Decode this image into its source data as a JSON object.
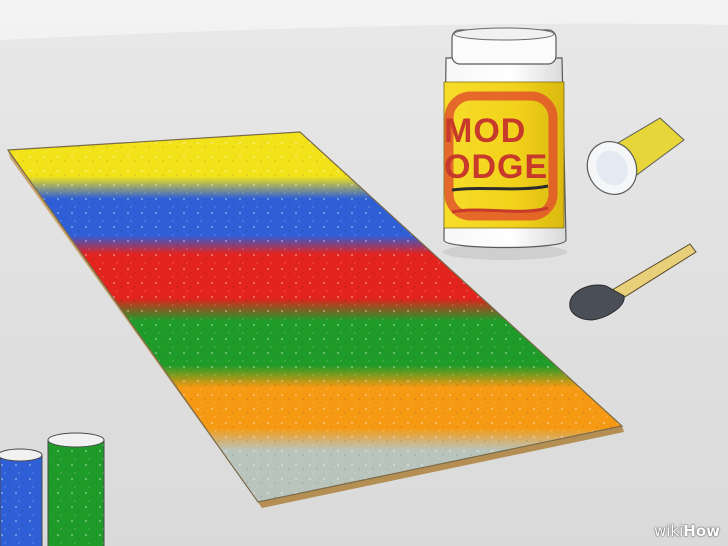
{
  "scene": {
    "description_colors": {
      "background_top": "#f4f4f4",
      "background_bottom": "#d9d9d9",
      "board_edge": "#c9a46a",
      "jar_label": "#f2d21a",
      "jar_lid": "#f7f7f7",
      "jar_text": "#c7392a",
      "brush_handle": "#e8cf7a",
      "brush_sponge": "#4a4f57"
    },
    "sand_bands": [
      {
        "name": "yellow",
        "color": "#f2e21a"
      },
      {
        "name": "blue",
        "color": "#2f5fd6"
      },
      {
        "name": "red",
        "color": "#e2231e"
      },
      {
        "name": "green",
        "color": "#1f9b2a"
      },
      {
        "name": "orange",
        "color": "#f59a12"
      },
      {
        "name": "silver",
        "color": "#b9c4bd"
      }
    ],
    "jar_text_line1": "MOD",
    "jar_text_line2": "ODGE",
    "small_jars": [
      {
        "name": "blue-sand-jar",
        "color": "#2f5fd6"
      },
      {
        "name": "green-sand-jar",
        "color": "#1f9b2a"
      }
    ],
    "glitter_tube_color": "#e6d63a"
  },
  "watermark": {
    "wiki": "wiki",
    "how": "How"
  }
}
